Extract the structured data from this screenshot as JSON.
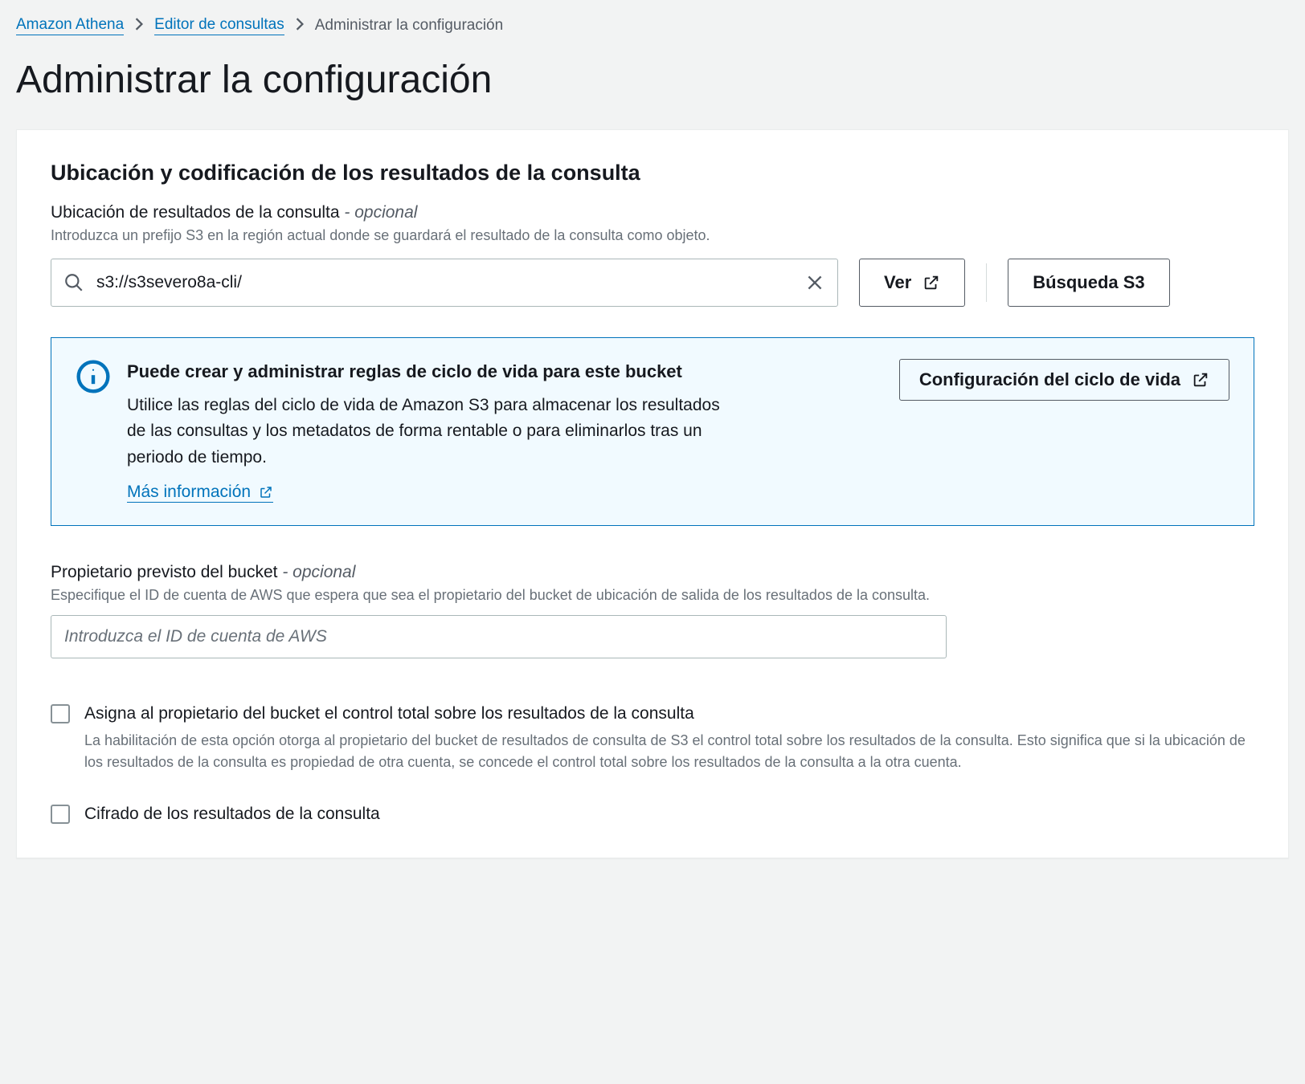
{
  "breadcrumb": {
    "items": [
      "Amazon Athena",
      "Editor de consultas"
    ],
    "current": "Administrar la configuración"
  },
  "page_title": "Administrar la configuración",
  "section": {
    "title": "Ubicación y codificación de los resultados de la consulta",
    "location": {
      "label": "Ubicación de resultados de la consulta",
      "optional": "- opcional",
      "help": "Introduzca un prefijo S3 en la región actual donde se guardará el resultado de la consulta como objeto.",
      "value": "s3://s3severo8a-cli/"
    },
    "buttons": {
      "view": "Ver",
      "search_s3": "Búsqueda S3"
    },
    "alert": {
      "title": "Puede crear y administrar reglas de ciclo de vida para este bucket",
      "desc": "Utilice las reglas del ciclo de vida de Amazon S3 para almacenar los resultados de las consultas y los metadatos de forma rentable o para eliminarlos tras un periodo de tiempo.",
      "more_link": "Más información",
      "action": "Configuración del ciclo de vida"
    },
    "owner": {
      "label": "Propietario previsto del bucket",
      "optional": "- opcional",
      "help": "Especifique el ID de cuenta de AWS que espera que sea el propietario del bucket de ubicación de salida de los resultados de la consulta.",
      "placeholder": "Introduzca el ID de cuenta de AWS"
    },
    "checkbox1": {
      "label": "Asigna al propietario del bucket el control total sobre los resultados de la consulta",
      "help": "La habilitación de esta opción otorga al propietario del bucket de resultados de consulta de S3 el control total sobre los resultados de la consulta. Esto significa que si la ubicación de los resultados de la consulta es propiedad de otra cuenta, se concede el control total sobre los resultados de la consulta a la otra cuenta."
    },
    "checkbox2": {
      "label": "Cifrado de los resultados de la consulta"
    }
  }
}
